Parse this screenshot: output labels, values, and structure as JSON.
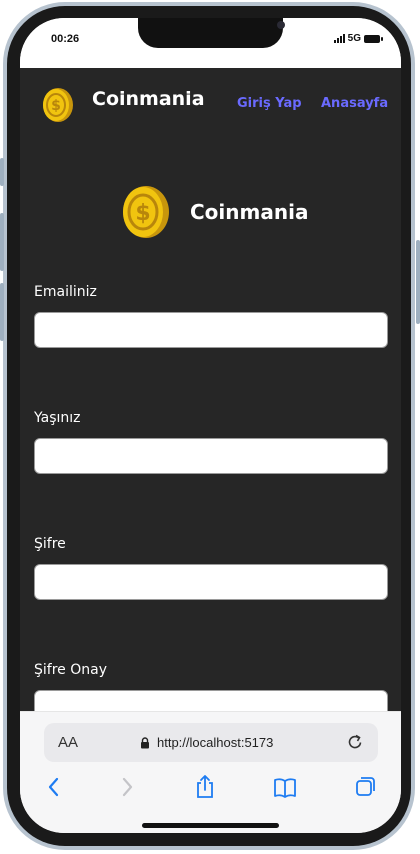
{
  "status_bar": {
    "time": "00:26",
    "network": "5G"
  },
  "nav": {
    "brand": "Coinmania",
    "login_link": "Giriş Yap",
    "home_link": "Anasayfa"
  },
  "logo": {
    "name": "Coinmania"
  },
  "form": {
    "fields": [
      {
        "label": "Emailiniz",
        "value": ""
      },
      {
        "label": "Yaşınız",
        "value": ""
      },
      {
        "label": "Şifre",
        "value": ""
      },
      {
        "label": "Şifre Onay",
        "value": ""
      }
    ]
  },
  "browser": {
    "text_size_label": "AA",
    "url": "http://localhost:5173",
    "icons": [
      "back-icon",
      "forward-icon",
      "share-icon",
      "bookmarks-icon",
      "tabs-icon",
      "reload-icon",
      "lock-icon"
    ]
  },
  "colors": {
    "app_bg": "#262626",
    "link": "#6a6aff",
    "coin_gold": "#f1c40f",
    "accent_blue": "#1e7cf2"
  }
}
